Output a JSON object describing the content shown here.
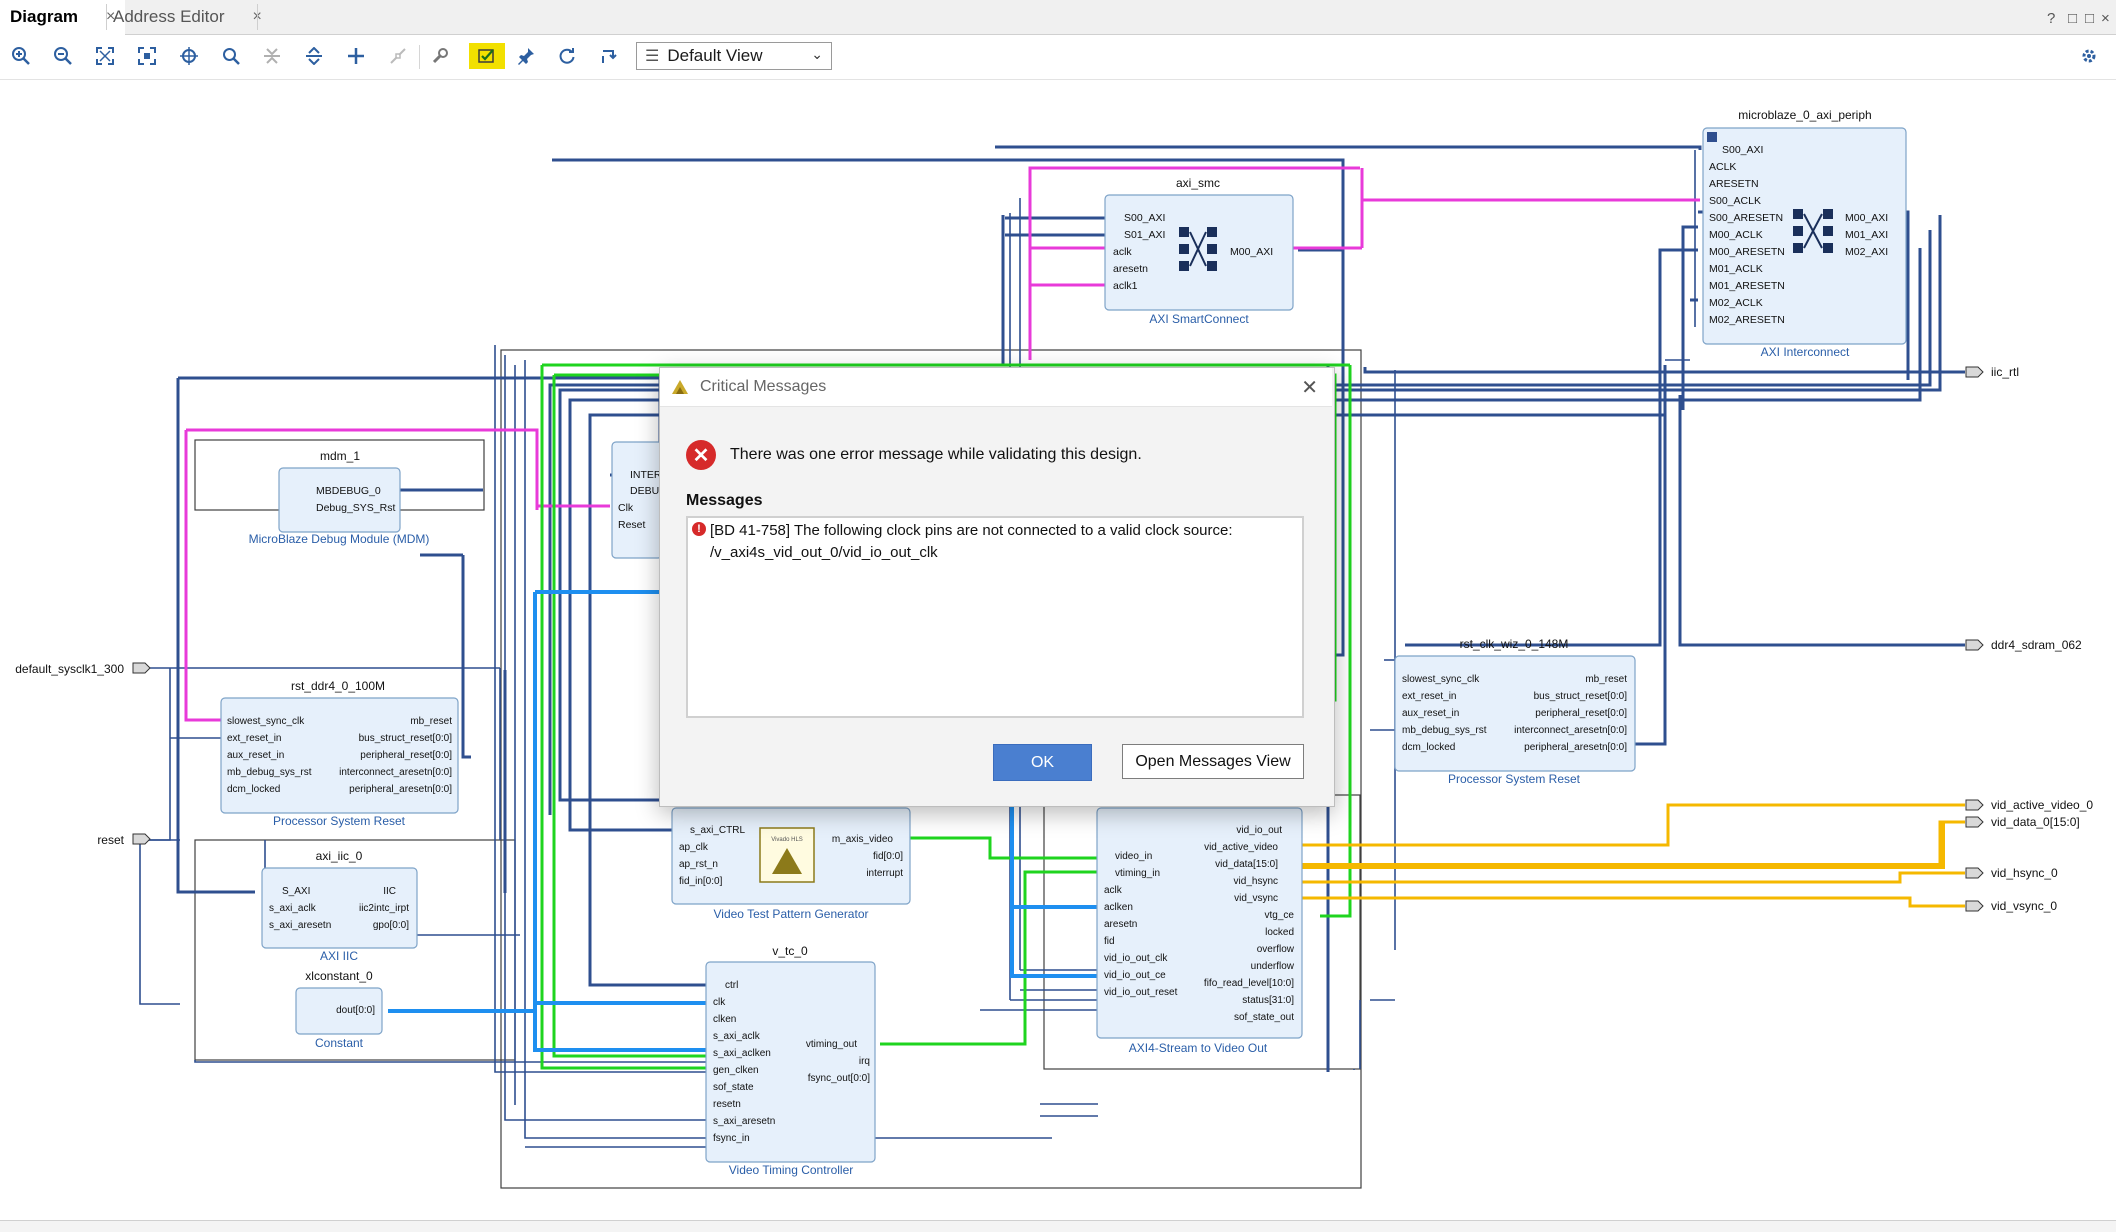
{
  "tabs": [
    {
      "label": "Diagram",
      "close": "×"
    },
    {
      "label": "Address Editor",
      "close": "×"
    }
  ],
  "window_controls": [
    "?",
    "□",
    "□",
    "×"
  ],
  "toolbar": {
    "view_select": "Default View",
    "icons": [
      "zoom-in-icon",
      "zoom-out-icon",
      "fit-icon",
      "fit-selection-icon",
      "select-area-icon",
      "search-icon",
      "collapse-all-icon",
      "expand-all-icon",
      "add-ip-icon",
      "disconnect-icon",
      "wrench-icon",
      "validate-icon",
      "pin-icon",
      "regenerate-icon",
      "auto-connect-icon"
    ]
  },
  "diagram": {
    "blocks": {
      "axi_periph": {
        "title": "microblaze_0_axi_periph",
        "caption": "AXI Interconnect",
        "left_ports": [
          "S00_AXI",
          "ACLK",
          "ARESETN",
          "S00_ACLK",
          "S00_ARESETN",
          "M00_ACLK",
          "M00_ARESETN",
          "M01_ACLK",
          "M01_ARESETN",
          "M02_ACLK",
          "M02_ARESETN"
        ],
        "right_ports": [
          "M00_AXI",
          "M01_AXI",
          "M02_AXI"
        ]
      },
      "axi_smc": {
        "title": "axi_smc",
        "caption": "AXI SmartConnect",
        "left_ports": [
          "S00_AXI",
          "S01_AXI",
          "aclk",
          "aresetn",
          "aclk1"
        ],
        "right_ports": [
          "M00_AXI"
        ]
      },
      "mdm": {
        "title": "mdm_1",
        "caption": "MicroBlaze Debug Module (MDM)",
        "ports": [
          "MBDEBUG_0",
          "Debug_SYS_Rst"
        ]
      },
      "microblaze_stub": {
        "ports": [
          "INTER",
          "DEBU",
          "Clk",
          "Reset"
        ]
      },
      "rst_ddr4": {
        "title": "rst_ddr4_0_100M",
        "caption": "Processor System Reset",
        "left_ports": [
          "slowest_sync_clk",
          "ext_reset_in",
          "aux_reset_in",
          "mb_debug_sys_rst",
          "dcm_locked"
        ],
        "right_ports": [
          "mb_reset",
          "bus_struct_reset[0:0]",
          "peripheral_reset[0:0]",
          "interconnect_aresetn[0:0]",
          "peripheral_aresetn[0:0]"
        ]
      },
      "rst_clk_wiz": {
        "title": "rst_clk_wiz_0_148M",
        "caption": "Processor System Reset",
        "left_ports": [
          "slowest_sync_clk",
          "ext_reset_in",
          "aux_reset_in",
          "mb_debug_sys_rst",
          "dcm_locked"
        ],
        "right_ports": [
          "mb_reset",
          "bus_struct_reset[0:0]",
          "peripheral_reset[0:0]",
          "interconnect_aresetn[0:0]",
          "peripheral_aresetn[0:0]"
        ]
      },
      "axi_iic": {
        "title": "axi_iic_0",
        "caption": "AXI IIC",
        "left_ports": [
          "S_AXI",
          "s_axi_aclk",
          "s_axi_aresetn"
        ],
        "right_ports": [
          "IIC",
          "iic2intc_irpt",
          "gpo[0:0]"
        ]
      },
      "constant": {
        "title": "xlconstant_0",
        "caption": "Constant",
        "ports": [
          "dout[0:0]"
        ]
      },
      "tpg": {
        "caption": "Video Test Pattern Generator",
        "logo_text": "Vivado HLS",
        "left_ports": [
          "s_axi_CTRL",
          "ap_clk",
          "ap_rst_n",
          "fid_in[0:0]"
        ],
        "right_ports": [
          "m_axis_video",
          "fid[0:0]",
          "interrupt"
        ]
      },
      "vtc": {
        "title": "v_tc_0",
        "caption": "Video Timing Controller",
        "left_ports": [
          "ctrl",
          "clk",
          "clken",
          "s_axi_aclk",
          "s_axi_aclken",
          "gen_clken",
          "sof_state",
          "resetn",
          "s_axi_aresetn",
          "fsync_in"
        ],
        "right_ports": [
          "vtiming_out",
          "irq",
          "fsync_out[0:0]"
        ]
      },
      "vidout": {
        "caption": "AXI4-Stream to Video Out",
        "left_ports": [
          "video_in",
          "vtiming_in",
          "aclk",
          "aclken",
          "aresetn",
          "fid",
          "vid_io_out_clk",
          "vid_io_out_ce",
          "vid_io_out_reset"
        ],
        "right_ports": [
          "vid_io_out",
          "vid_active_video",
          "vid_data[15:0]",
          "vid_hsync",
          "vid_vsync",
          "vtg_ce",
          "locked",
          "overflow",
          "underflow",
          "fifo_read_level[10:0]",
          "status[31:0]",
          "sof_state_out"
        ]
      }
    },
    "external_ports": {
      "sysclk": "default_sysclk1_300",
      "reset": "reset",
      "iic": "iic_rtl",
      "ddr4": "ddr4_sdram_062",
      "vid_active": "vid_active_video_0",
      "vid_data": "vid_data_0[15:0]",
      "vid_hsync": "vid_hsync_0",
      "vid_vsync": "vid_vsync_0"
    },
    "colors": {
      "net": "#2f4f8f",
      "block_fill": "#e6f0fb",
      "block_border": "#7ea3c8",
      "clock_net": "#e83ad9",
      "axis_net": "#1fd41f",
      "video_net": "#f5b800",
      "reset_net": "#1e8ff0"
    }
  },
  "dialog": {
    "title": "Critical Messages",
    "headline": "There was one error message while validating this design.",
    "messages_label": "Messages",
    "message_lines": [
      "[BD 41-758] The following clock pins are not connected to a valid clock source:",
      "/v_axi4s_vid_out_0/vid_io_out_clk"
    ],
    "ok_label": "OK",
    "open_view_label": "Open Messages View"
  }
}
